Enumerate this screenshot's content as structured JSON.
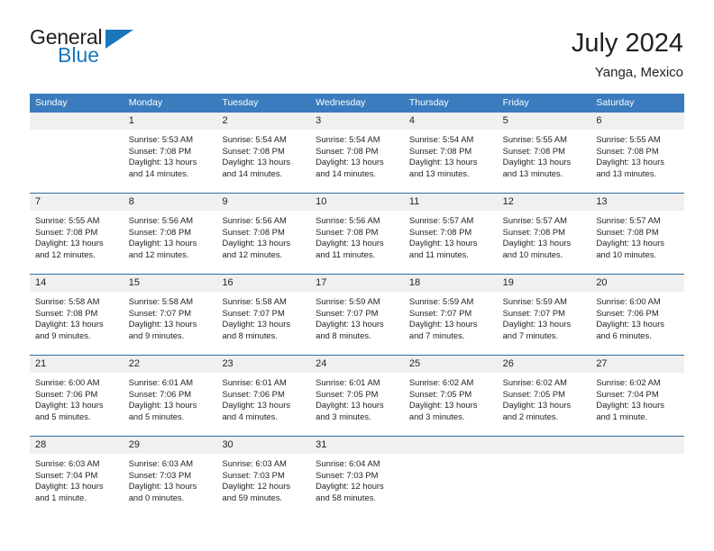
{
  "brand": {
    "name_part1": "General",
    "name_part2": "Blue",
    "accent_color": "#1b76bc"
  },
  "header": {
    "title": "July 2024",
    "location": "Yanga, Mexico"
  },
  "theme": {
    "header_row_bg": "#3a7cbe",
    "day_band_bg": "#f0f0f0",
    "week_divider": "#2e6da4",
    "text_color": "#231f20"
  },
  "columns": [
    "Sunday",
    "Monday",
    "Tuesday",
    "Wednesday",
    "Thursday",
    "Friday",
    "Saturday"
  ],
  "weeks": [
    [
      {
        "day": "",
        "lines": []
      },
      {
        "day": "1",
        "lines": [
          "Sunrise: 5:53 AM",
          "Sunset: 7:08 PM",
          "Daylight: 13 hours",
          "and 14 minutes."
        ]
      },
      {
        "day": "2",
        "lines": [
          "Sunrise: 5:54 AM",
          "Sunset: 7:08 PM",
          "Daylight: 13 hours",
          "and 14 minutes."
        ]
      },
      {
        "day": "3",
        "lines": [
          "Sunrise: 5:54 AM",
          "Sunset: 7:08 PM",
          "Daylight: 13 hours",
          "and 14 minutes."
        ]
      },
      {
        "day": "4",
        "lines": [
          "Sunrise: 5:54 AM",
          "Sunset: 7:08 PM",
          "Daylight: 13 hours",
          "and 13 minutes."
        ]
      },
      {
        "day": "5",
        "lines": [
          "Sunrise: 5:55 AM",
          "Sunset: 7:08 PM",
          "Daylight: 13 hours",
          "and 13 minutes."
        ]
      },
      {
        "day": "6",
        "lines": [
          "Sunrise: 5:55 AM",
          "Sunset: 7:08 PM",
          "Daylight: 13 hours",
          "and 13 minutes."
        ]
      }
    ],
    [
      {
        "day": "7",
        "lines": [
          "Sunrise: 5:55 AM",
          "Sunset: 7:08 PM",
          "Daylight: 13 hours",
          "and 12 minutes."
        ]
      },
      {
        "day": "8",
        "lines": [
          "Sunrise: 5:56 AM",
          "Sunset: 7:08 PM",
          "Daylight: 13 hours",
          "and 12 minutes."
        ]
      },
      {
        "day": "9",
        "lines": [
          "Sunrise: 5:56 AM",
          "Sunset: 7:08 PM",
          "Daylight: 13 hours",
          "and 12 minutes."
        ]
      },
      {
        "day": "10",
        "lines": [
          "Sunrise: 5:56 AM",
          "Sunset: 7:08 PM",
          "Daylight: 13 hours",
          "and 11 minutes."
        ]
      },
      {
        "day": "11",
        "lines": [
          "Sunrise: 5:57 AM",
          "Sunset: 7:08 PM",
          "Daylight: 13 hours",
          "and 11 minutes."
        ]
      },
      {
        "day": "12",
        "lines": [
          "Sunrise: 5:57 AM",
          "Sunset: 7:08 PM",
          "Daylight: 13 hours",
          "and 10 minutes."
        ]
      },
      {
        "day": "13",
        "lines": [
          "Sunrise: 5:57 AM",
          "Sunset: 7:08 PM",
          "Daylight: 13 hours",
          "and 10 minutes."
        ]
      }
    ],
    [
      {
        "day": "14",
        "lines": [
          "Sunrise: 5:58 AM",
          "Sunset: 7:08 PM",
          "Daylight: 13 hours",
          "and 9 minutes."
        ]
      },
      {
        "day": "15",
        "lines": [
          "Sunrise: 5:58 AM",
          "Sunset: 7:07 PM",
          "Daylight: 13 hours",
          "and 9 minutes."
        ]
      },
      {
        "day": "16",
        "lines": [
          "Sunrise: 5:58 AM",
          "Sunset: 7:07 PM",
          "Daylight: 13 hours",
          "and 8 minutes."
        ]
      },
      {
        "day": "17",
        "lines": [
          "Sunrise: 5:59 AM",
          "Sunset: 7:07 PM",
          "Daylight: 13 hours",
          "and 8 minutes."
        ]
      },
      {
        "day": "18",
        "lines": [
          "Sunrise: 5:59 AM",
          "Sunset: 7:07 PM",
          "Daylight: 13 hours",
          "and 7 minutes."
        ]
      },
      {
        "day": "19",
        "lines": [
          "Sunrise: 5:59 AM",
          "Sunset: 7:07 PM",
          "Daylight: 13 hours",
          "and 7 minutes."
        ]
      },
      {
        "day": "20",
        "lines": [
          "Sunrise: 6:00 AM",
          "Sunset: 7:06 PM",
          "Daylight: 13 hours",
          "and 6 minutes."
        ]
      }
    ],
    [
      {
        "day": "21",
        "lines": [
          "Sunrise: 6:00 AM",
          "Sunset: 7:06 PM",
          "Daylight: 13 hours",
          "and 5 minutes."
        ]
      },
      {
        "day": "22",
        "lines": [
          "Sunrise: 6:01 AM",
          "Sunset: 7:06 PM",
          "Daylight: 13 hours",
          "and 5 minutes."
        ]
      },
      {
        "day": "23",
        "lines": [
          "Sunrise: 6:01 AM",
          "Sunset: 7:06 PM",
          "Daylight: 13 hours",
          "and 4 minutes."
        ]
      },
      {
        "day": "24",
        "lines": [
          "Sunrise: 6:01 AM",
          "Sunset: 7:05 PM",
          "Daylight: 13 hours",
          "and 3 minutes."
        ]
      },
      {
        "day": "25",
        "lines": [
          "Sunrise: 6:02 AM",
          "Sunset: 7:05 PM",
          "Daylight: 13 hours",
          "and 3 minutes."
        ]
      },
      {
        "day": "26",
        "lines": [
          "Sunrise: 6:02 AM",
          "Sunset: 7:05 PM",
          "Daylight: 13 hours",
          "and 2 minutes."
        ]
      },
      {
        "day": "27",
        "lines": [
          "Sunrise: 6:02 AM",
          "Sunset: 7:04 PM",
          "Daylight: 13 hours",
          "and 1 minute."
        ]
      }
    ],
    [
      {
        "day": "28",
        "lines": [
          "Sunrise: 6:03 AM",
          "Sunset: 7:04 PM",
          "Daylight: 13 hours",
          "and 1 minute."
        ]
      },
      {
        "day": "29",
        "lines": [
          "Sunrise: 6:03 AM",
          "Sunset: 7:03 PM",
          "Daylight: 13 hours",
          "and 0 minutes."
        ]
      },
      {
        "day": "30",
        "lines": [
          "Sunrise: 6:03 AM",
          "Sunset: 7:03 PM",
          "Daylight: 12 hours",
          "and 59 minutes."
        ]
      },
      {
        "day": "31",
        "lines": [
          "Sunrise: 6:04 AM",
          "Sunset: 7:03 PM",
          "Daylight: 12 hours",
          "and 58 minutes."
        ]
      },
      {
        "day": "",
        "lines": []
      },
      {
        "day": "",
        "lines": []
      },
      {
        "day": "",
        "lines": []
      }
    ]
  ]
}
